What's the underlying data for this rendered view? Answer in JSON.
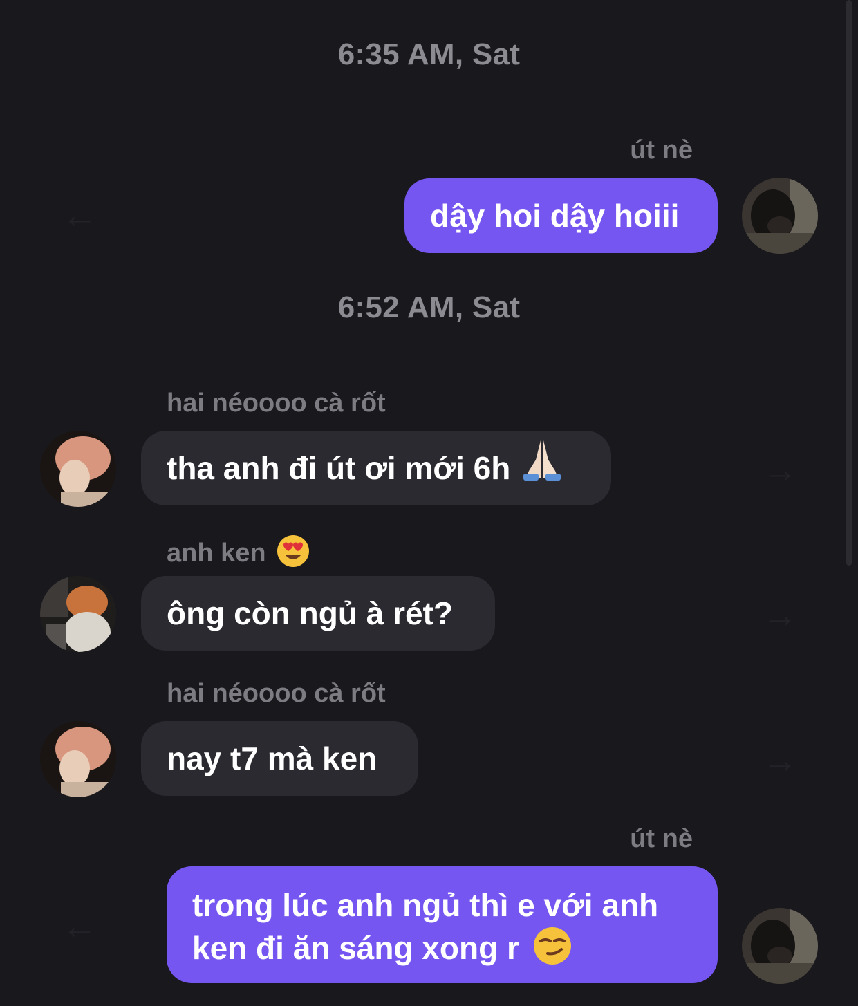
{
  "timestamps": [
    "6:35 AM, Sat",
    "6:52 AM, Sat"
  ],
  "messages": [
    {
      "sender": "út nè",
      "text": "dậy hoi dậy hoiii",
      "direction": "outgoing",
      "reaction_icon": "share-arrow-left-icon"
    },
    {
      "sender": "hai néoooo cà rốt",
      "text": "tha anh đi út ơi mới 6h",
      "emoji": "folded-hands-icon",
      "direction": "incoming",
      "reaction_icon": "share-arrow-right-icon"
    },
    {
      "sender": "anh ken",
      "sender_emoji": "heart-eyes-icon",
      "text": "ông còn ngủ à rét?",
      "direction": "incoming",
      "reaction_icon": "share-arrow-right-icon"
    },
    {
      "sender": "hai néoooo cà rốt",
      "text": "nay t7 mà ken",
      "direction": "incoming",
      "reaction_icon": "share-arrow-right-icon"
    },
    {
      "sender": "út nè",
      "text_line1": "trong lúc anh ngủ thì e với anh",
      "text_line2": "ken đi ăn sáng xong r",
      "emoji": "smirking-face-icon",
      "direction": "outgoing",
      "reaction_icon": "share-arrow-left-icon"
    }
  ],
  "colors": {
    "background": "#19181d",
    "outgoing_bubble": "#7656f0",
    "incoming_bubble": "#2b2a30",
    "timestamp_text": "#8c8b91",
    "sender_text": "#7d7c82"
  },
  "arrows": {
    "left": "←",
    "right": "→"
  }
}
